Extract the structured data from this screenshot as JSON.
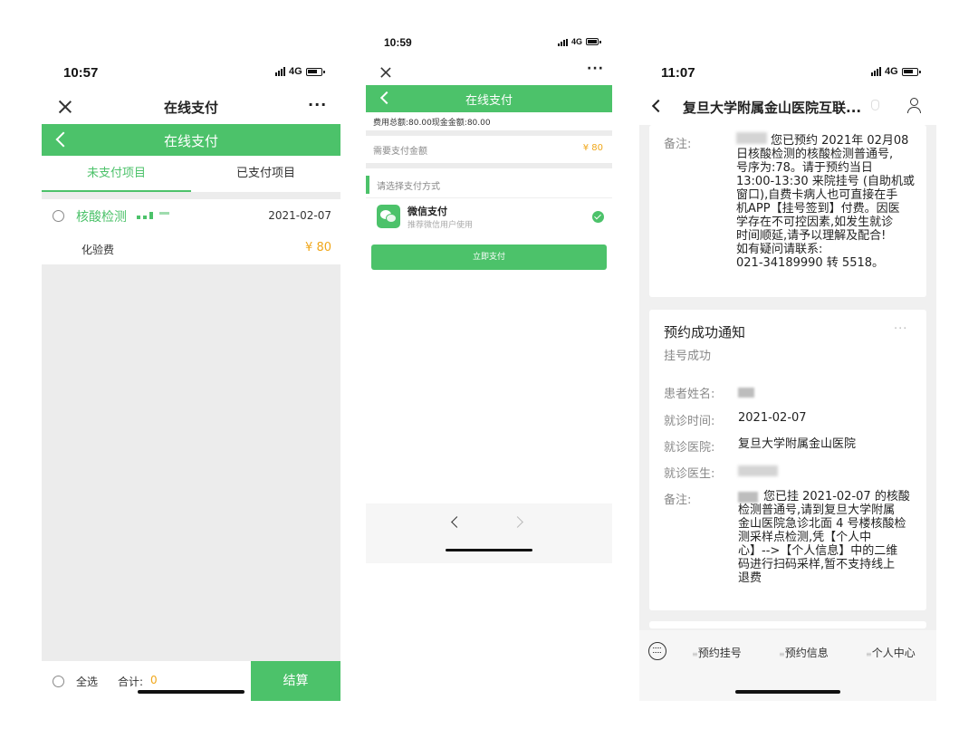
{
  "phone1": {
    "status_time": "10:57",
    "network": "4G",
    "nav_title": "在线支付",
    "header_title": "在线支付",
    "tab_unpaid": "未支付项目",
    "tab_paid": "已支付项目",
    "item_name": "核酸检测",
    "item_date": "2021-02-07",
    "fee_name": "化验费",
    "fee_amount": "¥ 80",
    "select_all": "全选",
    "total_label": "合计:",
    "total_value": "0",
    "checkout": "结算",
    "colors": {
      "accent": "#4cc26a",
      "price": "#f0a71a"
    }
  },
  "phone2": {
    "status_time": "10:59",
    "network": "4G",
    "header_title": "在线支付",
    "summary": "费用总额:80.00现金金额:80.00",
    "amount_label": "需要支付金额",
    "amount_value": "¥ 80",
    "choose_method": "请选择支付方式",
    "wechat_pay": "微信支付",
    "wechat_sub": "推荐微信用户使用",
    "pay_now": "立即支付"
  },
  "phone3": {
    "status_time": "11:07",
    "network": "4G",
    "nav_title": "复旦大学附属金山医院互联...",
    "note1_label": "备注:",
    "note1_lines": [
      "您已预约 2021年 02月08",
      "日核酸检测的核酸检测普通号,",
      "号序为:78。请于预约当日",
      "13:00-13:30 来院挂号 (自助机或",
      "窗口),自费卡病人也可直接在手",
      "机APP【挂号签到】付费。因医",
      "学存在不可控因素,如发生就诊",
      "时间顺延,请予以理解及配合!",
      "如有疑问请联系:",
      "021-34189990 转 5518。"
    ],
    "card_title": "预约成功通知",
    "card_subtitle": "挂号成功",
    "patient_label": "患者姓名:",
    "visit_time_label": "就诊时间:",
    "visit_time_value": "2021-02-07",
    "hospital_label": "就诊医院:",
    "hospital_value": "复旦大学附属金山医院",
    "doctor_label": "就诊医生:",
    "note2_label": "备注:",
    "note2_lines": [
      "您已挂 2021-02-07 的核酸",
      "检测普通号,请到复旦大学附属",
      "金山医院急诊北面 4 号楼核酸检",
      "测采样点检测,凭【个人中",
      "心】-->【个人信息】中的二维",
      "码进行扫码采样,暂不支持线上",
      "退费"
    ],
    "menu": [
      "预约挂号",
      "预约信息",
      "个人中心"
    ]
  }
}
